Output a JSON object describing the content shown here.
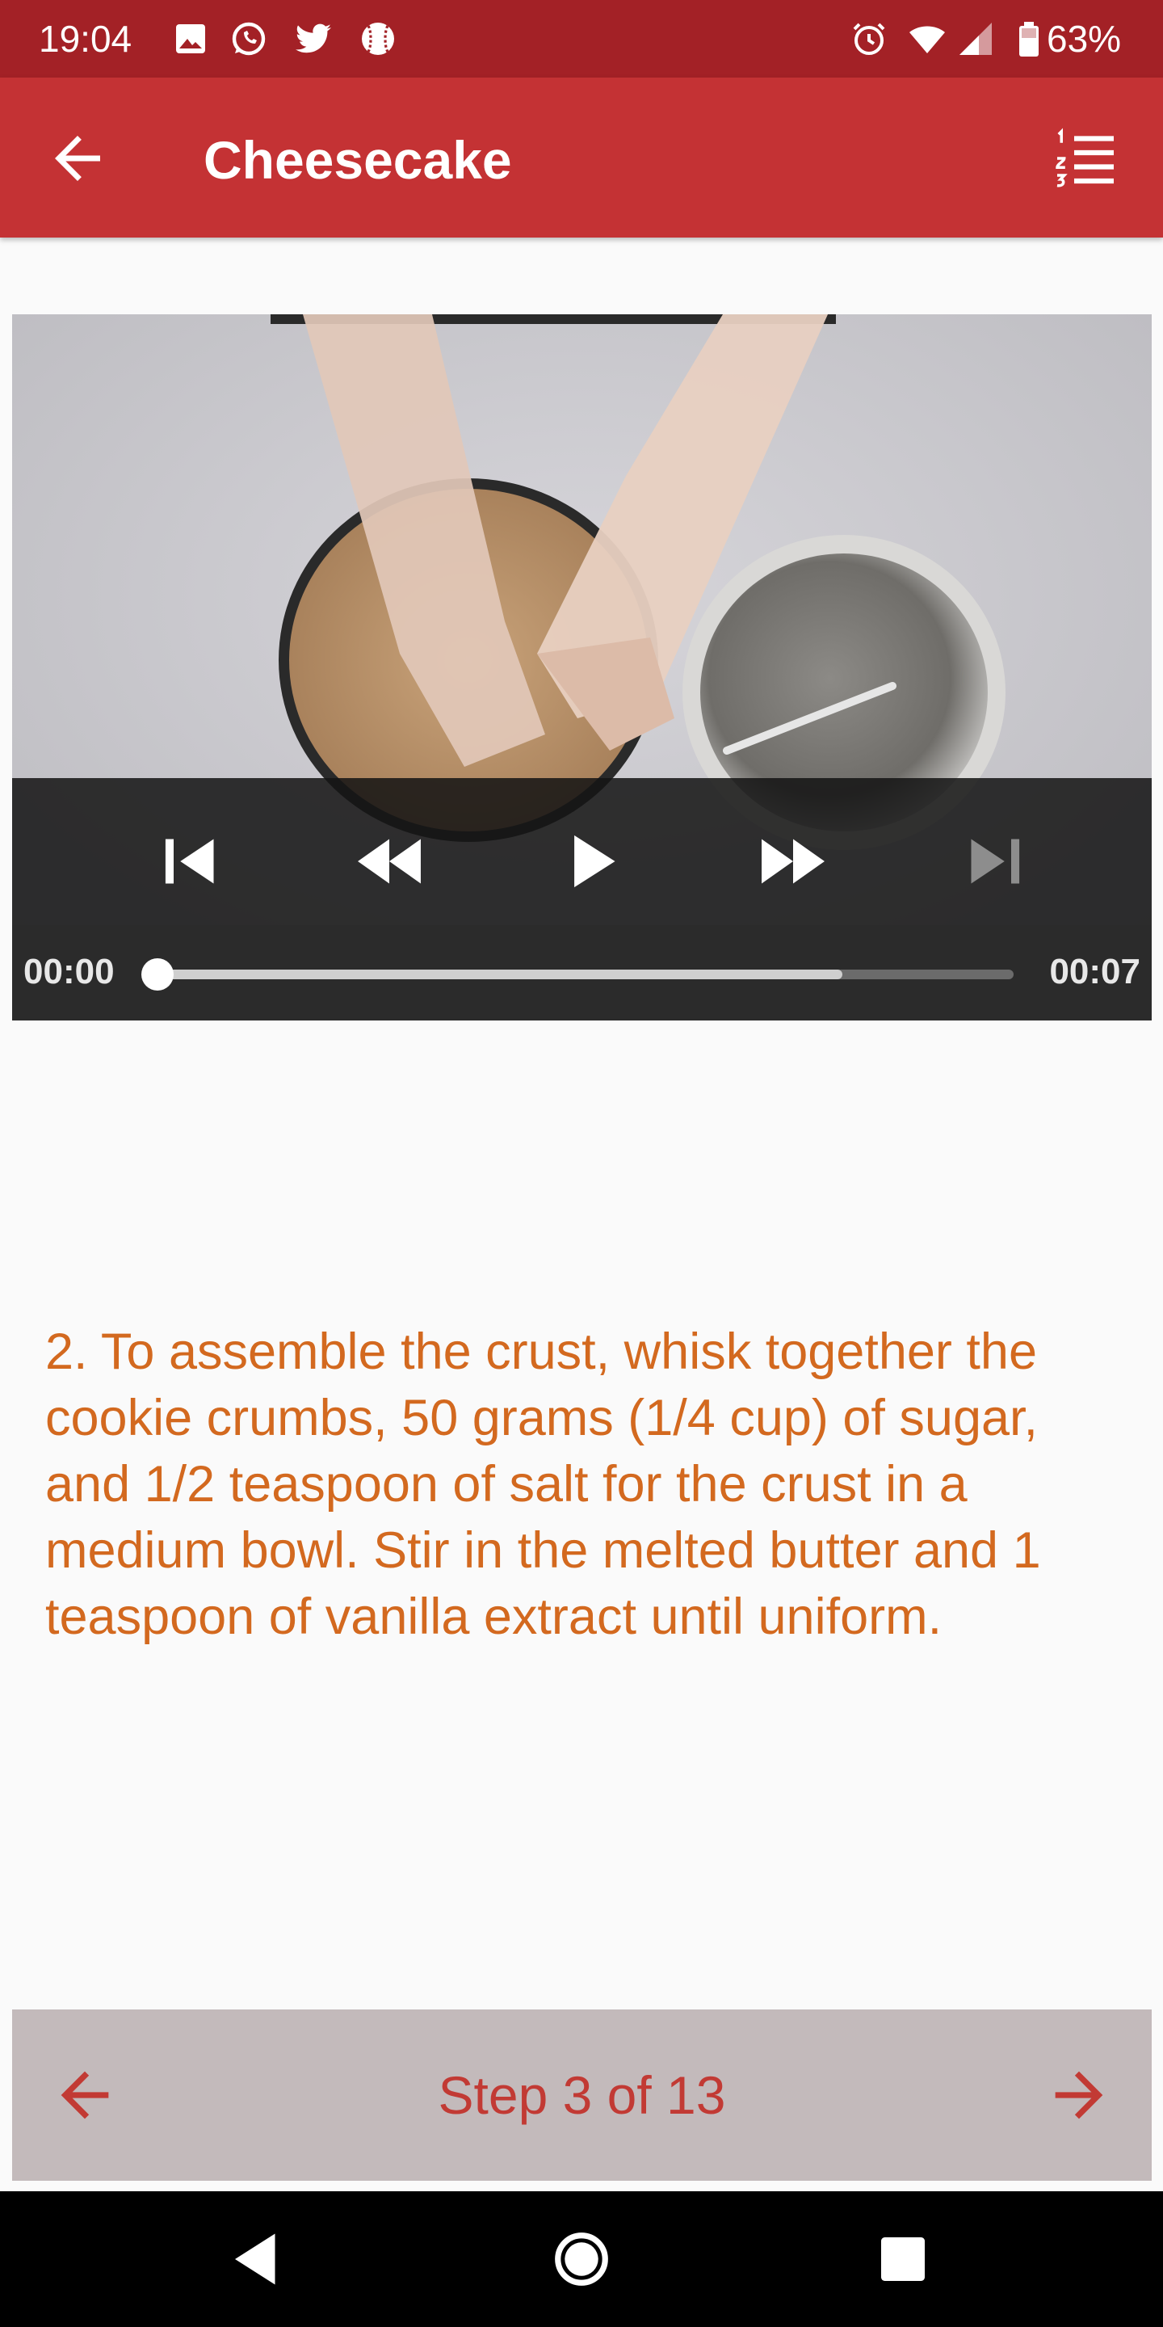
{
  "status_bar": {
    "time": "19:04",
    "battery": "63%",
    "icons": [
      "photo-icon",
      "whatsapp-icon",
      "twitter-icon",
      "baseball-icon",
      "alarm-icon",
      "wifi-icon",
      "signal-icon",
      "battery-icon"
    ]
  },
  "app_bar": {
    "title": "Cheesecake",
    "back_icon": "arrow-back-icon",
    "steps_icon": "numbered-list-icon"
  },
  "video": {
    "position": "00:00",
    "duration": "00:07",
    "progress_fraction": 0,
    "buffered_fraction": 0.8,
    "controls": [
      "previous",
      "rewind",
      "play",
      "fast-forward",
      "next"
    ],
    "next_disabled": true
  },
  "instruction": {
    "text": "2. To assemble the crust, whisk together the cookie crumbs, 50 grams (1/4 cup) of sugar, and 1/2 teaspoon of salt for the crust in a medium bowl. Stir in the melted butter and 1 teaspoon of vanilla extract until uniform."
  },
  "step_nav": {
    "label": "Step 3 of 13",
    "current": 3,
    "total": 13
  },
  "colors": {
    "status_bar": "#a32126",
    "app_bar": "#c43234",
    "instruction_text": "#d3691f",
    "step_nav_bg": "#c3babb",
    "step_nav_text": "#c23a34"
  }
}
